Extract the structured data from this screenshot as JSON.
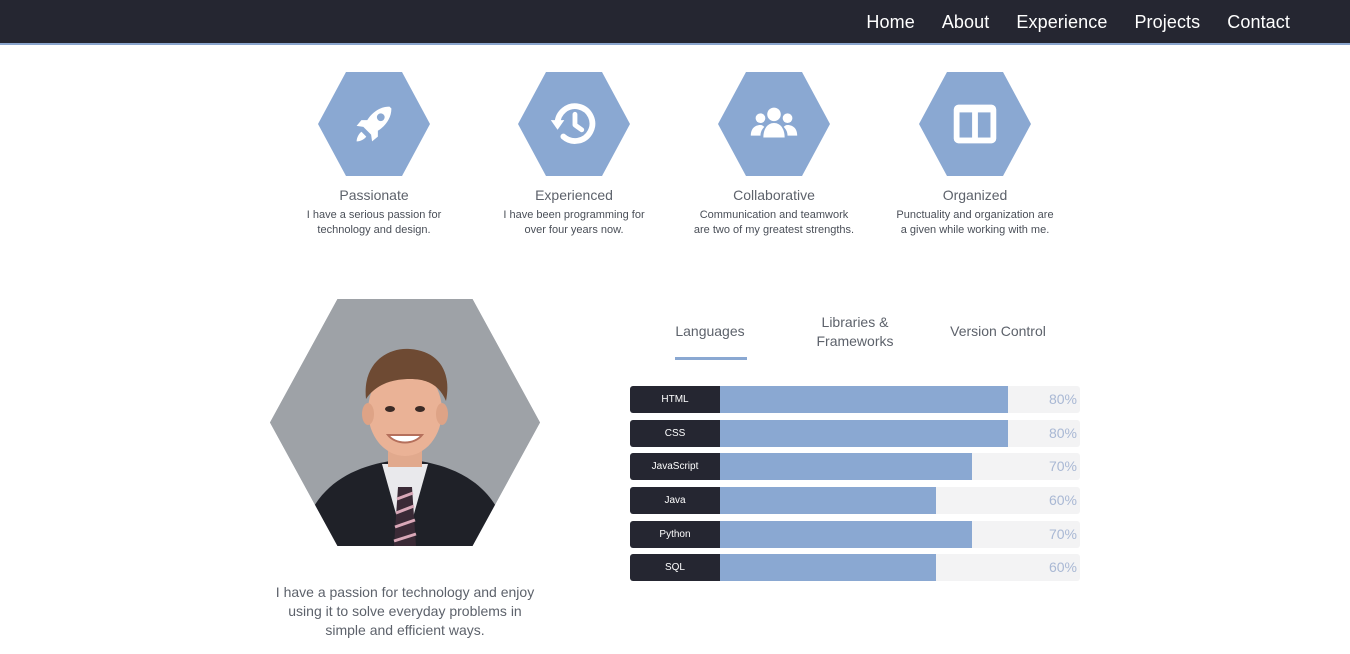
{
  "nav": {
    "items": [
      {
        "label": "Home"
      },
      {
        "label": "About"
      },
      {
        "label": "Experience"
      },
      {
        "label": "Projects"
      },
      {
        "label": "Contact"
      }
    ]
  },
  "features": [
    {
      "icon": "rocket-icon",
      "title": "Passionate",
      "line1": "I have a serious passion for",
      "line2": "technology and design."
    },
    {
      "icon": "history-icon",
      "title": "Experienced",
      "line1": "I have been programming for",
      "line2": "over four years now."
    },
    {
      "icon": "users-icon",
      "title": "Collaborative",
      "line1": "Communication and teamwork",
      "line2": "are two of my greatest strengths."
    },
    {
      "icon": "columns-icon",
      "title": "Organized",
      "line1": "Punctuality and organization are",
      "line2": "a given while working with me."
    }
  ],
  "about": {
    "bio_line1": "I have a passion for technology and enjoy",
    "bio_line2": "using it to solve everyday problems in",
    "bio_line3": "simple and efficient ways."
  },
  "skills": {
    "tabs": [
      {
        "line1": "Languages",
        "line2": "",
        "active": true
      },
      {
        "line1": "Libraries &",
        "line2": "Frameworks",
        "active": false
      },
      {
        "line1": "Version Control",
        "line2": "",
        "active": false
      }
    ],
    "bars": [
      {
        "label": "HTML",
        "percent": 80,
        "percent_label": "80%"
      },
      {
        "label": "CSS",
        "percent": 80,
        "percent_label": "80%"
      },
      {
        "label": "JavaScript",
        "percent": 70,
        "percent_label": "70%"
      },
      {
        "label": "Java",
        "percent": 60,
        "percent_label": "60%"
      },
      {
        "label": "Python",
        "percent": 70,
        "percent_label": "70%"
      },
      {
        "label": "SQL",
        "percent": 60,
        "percent_label": "60%"
      }
    ]
  },
  "colors": {
    "nav_bg": "#252631",
    "accent": "#8aa8d2",
    "bar_track": "#f3f3f4",
    "label_bg": "#252631"
  }
}
